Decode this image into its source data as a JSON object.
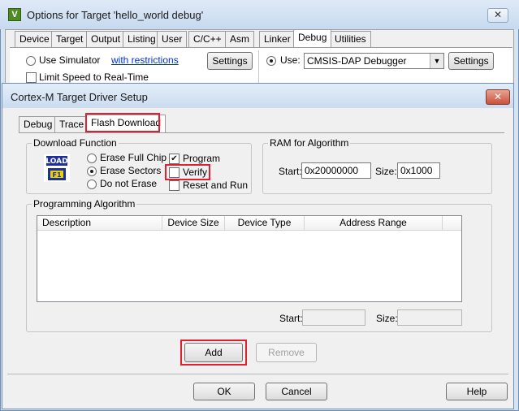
{
  "outer_window": {
    "title": "Options for Target 'hello_world debug'",
    "app_icon_letter": "V",
    "close_symbol": "✕",
    "tabs": [
      {
        "label": "Device"
      },
      {
        "label": "Target"
      },
      {
        "label": "Output"
      },
      {
        "label": "Listing"
      },
      {
        "label": "User"
      },
      {
        "label": "C/C++"
      },
      {
        "label": "Asm"
      },
      {
        "label": "Linker"
      },
      {
        "label": "Debug",
        "active": true
      },
      {
        "label": "Utilities"
      }
    ],
    "use_simulator_label": "Use Simulator",
    "with_restrictions_link": "with restrictions",
    "settings_left_label": "Settings",
    "limit_speed_label": "Limit Speed to Real-Time",
    "use_label": "Use:",
    "debugger_value": "CMSIS-DAP Debugger",
    "settings_right_label": "Settings",
    "ok_label": "OK",
    "cancel_label": "Cancel",
    "help_label": "Help"
  },
  "dialog": {
    "title": "Cortex-M Target Driver Setup",
    "close_symbol": "✕",
    "tabs": [
      {
        "label": "Debug"
      },
      {
        "label": "Trace"
      },
      {
        "label": "Flash Download",
        "active": true
      }
    ],
    "download_function": {
      "label": "Download Function",
      "icon_text_top": "LOAD",
      "icon_text_bottom": "F1",
      "erase_full_chip": "Erase Full Chip",
      "erase_sectors": "Erase Sectors",
      "do_not_erase": "Do not Erase",
      "selected_erase": "erase_sectors",
      "program": "Program",
      "program_checked": true,
      "verify": "Verify",
      "verify_checked": false,
      "reset_and_run": "Reset and Run",
      "reset_checked": false
    },
    "ram_for_algorithm": {
      "label": "RAM for Algorithm",
      "start_label": "Start:",
      "start_value": "0x20000000",
      "size_label": "Size:",
      "size_value": "0x1000"
    },
    "programming_algorithm": {
      "label": "Programming Algorithm",
      "columns": [
        "Description",
        "Device Size",
        "Device Type",
        "Address Range"
      ],
      "start_label": "Start:",
      "size_label": "Size:"
    },
    "add_label": "Add",
    "remove_label": "Remove"
  },
  "colors": {
    "highlight_red": "#e0202f",
    "link_blue": "#0033cc"
  }
}
